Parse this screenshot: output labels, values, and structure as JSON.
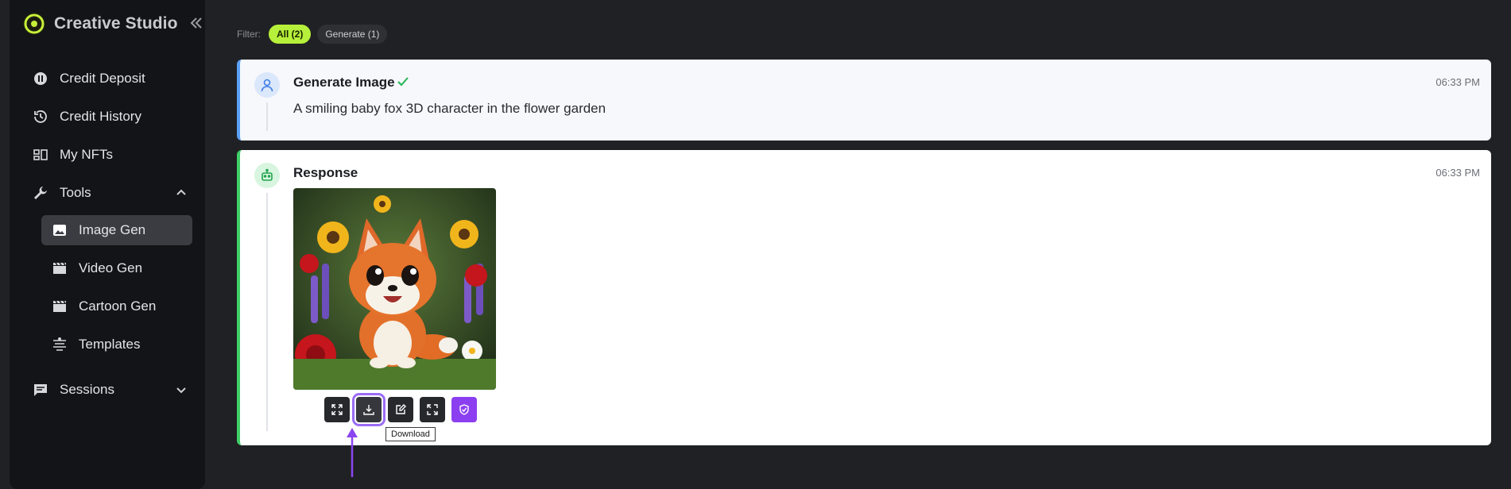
{
  "app": {
    "name": "Creative Studio"
  },
  "sidebar": {
    "items": [
      {
        "label": "Credit Deposit",
        "icon": "coin-icon"
      },
      {
        "label": "Credit History",
        "icon": "history-icon"
      },
      {
        "label": "My NFTs",
        "icon": "nft-icon"
      },
      {
        "label": "Tools",
        "icon": "wrench-icon",
        "expanded": true
      },
      {
        "label": "Image Gen",
        "icon": "image-icon",
        "active": true
      },
      {
        "label": "Video Gen",
        "icon": "clapper-icon"
      },
      {
        "label": "Cartoon Gen",
        "icon": "clapper-icon"
      },
      {
        "label": "Templates",
        "icon": "templates-icon"
      },
      {
        "label": "Sessions",
        "icon": "chat-icon",
        "expanded": false
      }
    ]
  },
  "filter": {
    "label": "Filter:",
    "chips": [
      {
        "label": "All (2)",
        "active": true
      },
      {
        "label": "Generate (1)",
        "active": false
      }
    ]
  },
  "prompt_card": {
    "title": "Generate Image",
    "time": "06:33 PM",
    "text": "A smiling baby fox 3D character in the flower garden"
  },
  "response_card": {
    "title": "Response",
    "time": "06:33 PM",
    "image_alt": "A smiling baby fox 3D character in the flower garden",
    "actions": [
      {
        "name": "expand",
        "icon": "expand-icon"
      },
      {
        "name": "download",
        "icon": "download-icon",
        "tooltip": "Download",
        "highlighted": true
      },
      {
        "name": "edit",
        "icon": "edit-icon"
      },
      {
        "name": "upscale",
        "icon": "upscale-icon"
      },
      {
        "name": "protect",
        "icon": "shield-icon"
      }
    ]
  },
  "colors": {
    "accent_green": "#b6f03a",
    "prompt_border": "#5aa0f5",
    "response_border": "#3fcf68",
    "highlight_purple": "#8b3ff0"
  }
}
